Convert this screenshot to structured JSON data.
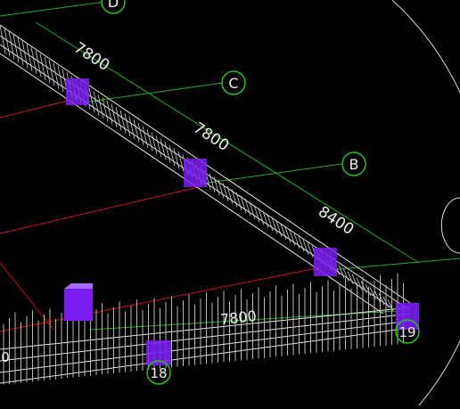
{
  "viewport": {
    "background": "#000000",
    "colors": {
      "grid_green": "#1fae1f",
      "grid_red": "#c8161e",
      "bubble_green": "#22c322",
      "dim_text": "#f0f0f0",
      "beam_white": "#e8e8e8",
      "pile_gray": "#bdb6b0",
      "column_purple": "#7a1ef0",
      "orbit_white": "#d8d8d8"
    }
  },
  "grid_bubbles": {
    "D": "D",
    "C": "C",
    "B": "B",
    "n18": "18",
    "n19": "19"
  },
  "dimensions": {
    "dim1": "7800",
    "dim2": "7800",
    "dim3": "8400",
    "dim4": "7800",
    "dim5": "0"
  }
}
